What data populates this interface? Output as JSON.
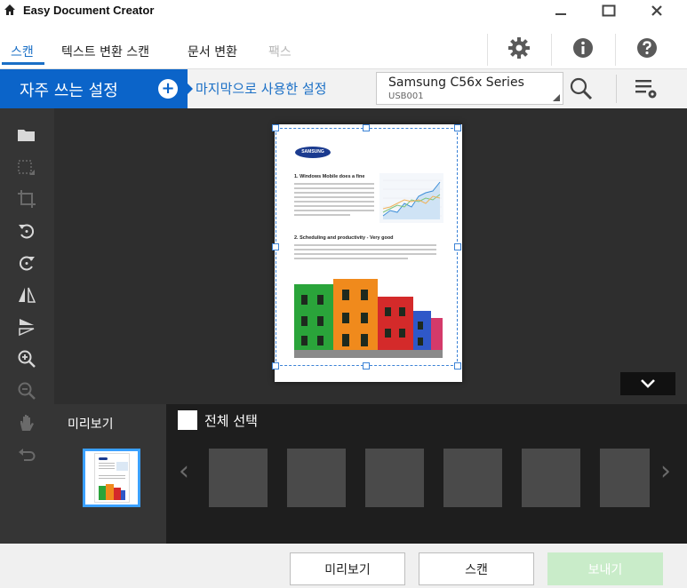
{
  "window": {
    "title": "Easy Document Creator"
  },
  "tabs": [
    {
      "label": "스캔",
      "state": "active"
    },
    {
      "label": "텍스트 변환 스캔",
      "state": "normal"
    },
    {
      "label": "문서 변환",
      "state": "normal"
    },
    {
      "label": "팩스",
      "state": "disabled"
    }
  ],
  "favorites": {
    "button_label": "자주 쓰는 설정",
    "last_used_label": "마지막으로 사용한 설정"
  },
  "device": {
    "name": "Samsung C56x Series",
    "port": "USB001"
  },
  "preview_panel": {
    "label": "미리보기"
  },
  "thumbnails": {
    "select_all_label": "전체 선택"
  },
  "footer": {
    "preview_button": "미리보기",
    "scan_button": "스캔",
    "send_button": "보내기"
  },
  "document": {
    "logo_text": "SAMSUNG",
    "heading1": "1. Windows Mobile does a fine",
    "heading2": "2. Scheduling and productivity - Very good"
  },
  "colors": {
    "accent": "#0b64c9",
    "link": "#1a6fc6",
    "send_disabled": "#c9ecc9"
  }
}
